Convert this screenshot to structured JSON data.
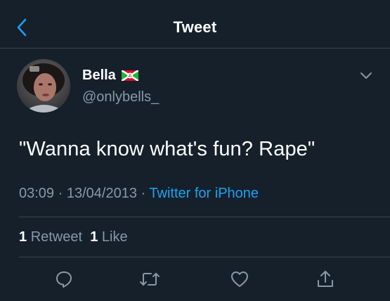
{
  "header": {
    "title": "Tweet",
    "back_icon": "chevron-left-icon",
    "accent_color": "#1da1f2"
  },
  "tweet": {
    "display_name": "Bella",
    "handle": "@onlybells_",
    "flag_icon": "burundi-flag-icon",
    "text": "\"Wanna know what's fun? Rape\"",
    "time": "03:09",
    "date": "13/04/2013",
    "separator": "·",
    "source": "Twitter for iPhone",
    "retweet_count": "1",
    "retweet_label": "Retweet",
    "like_count": "1",
    "like_label": "Like"
  },
  "actions": {
    "reply_icon": "reply-icon",
    "retweet_icon": "retweet-icon",
    "like_icon": "heart-icon",
    "share_icon": "share-icon"
  },
  "colors": {
    "background": "#15202b",
    "border": "#38444d",
    "secondary_text": "#8899a6",
    "link": "#1da1f2"
  }
}
